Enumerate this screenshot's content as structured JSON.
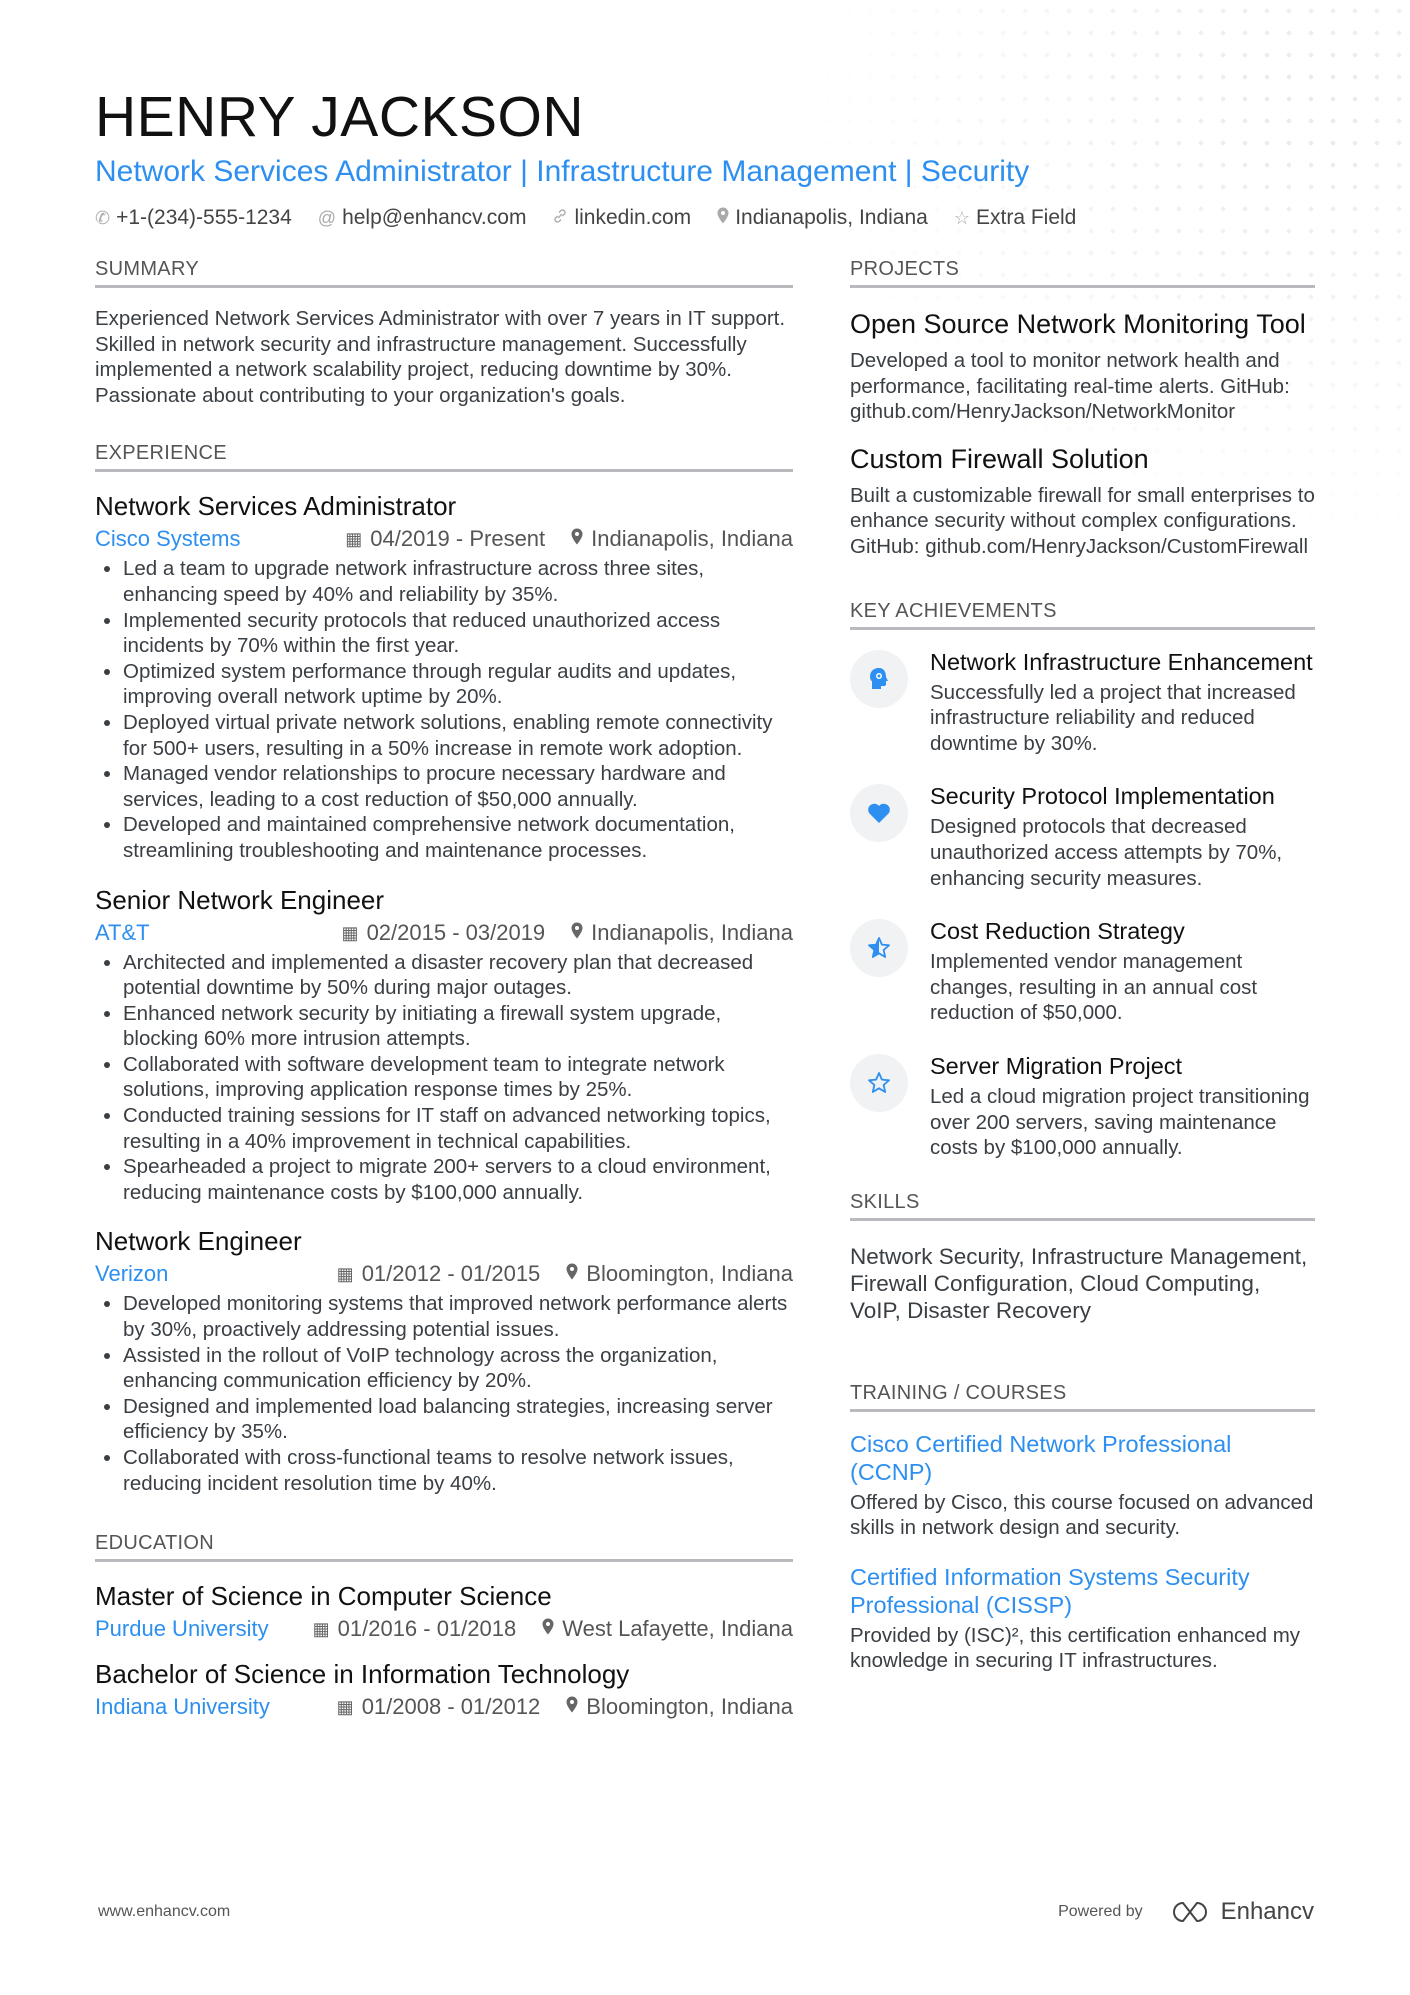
{
  "header": {
    "name": "HENRY JACKSON",
    "title": "Network Services Administrator | Infrastructure Management | Security",
    "contacts": [
      {
        "icon": "phone-icon",
        "glyph": "✆",
        "text": "+1-(234)-555-1234"
      },
      {
        "icon": "at-icon",
        "glyph": "@",
        "text": "help@enhancv.com"
      },
      {
        "icon": "link-icon",
        "glyph": "🔗",
        "text": "linkedin.com"
      },
      {
        "icon": "location-pin-icon",
        "glyph": "⚲",
        "text": "Indianapolis, Indiana"
      },
      {
        "icon": "star-icon",
        "glyph": "☆",
        "text": "Extra Field"
      }
    ]
  },
  "summary": {
    "heading": "SUMMARY",
    "text": "Experienced Network Services Administrator with over 7 years in IT support. Skilled in network security and infrastructure management. Successfully implemented a network scalability project, reducing downtime by 30%. Passionate about contributing to your organization's goals."
  },
  "experience": {
    "heading": "EXPERIENCE",
    "jobs": [
      {
        "title": "Network Services Administrator",
        "company": "Cisco Systems",
        "dates": "04/2019 - Present",
        "location": "Indianapolis, Indiana",
        "bullets": [
          "Led a team to upgrade network infrastructure across three sites, enhancing speed by 40% and reliability by 35%.",
          "Implemented security protocols that reduced unauthorized access incidents by 70% within the first year.",
          "Optimized system performance through regular audits and updates, improving overall network uptime by 20%.",
          "Deployed virtual private network solutions, enabling remote connectivity for 500+ users, resulting in a 50% increase in remote work adoption.",
          "Managed vendor relationships to procure necessary hardware and services, leading to a cost reduction of $50,000 annually.",
          "Developed and maintained comprehensive network documentation, streamlining troubleshooting and maintenance processes."
        ]
      },
      {
        "title": "Senior Network Engineer",
        "company": "AT&T",
        "dates": "02/2015 - 03/2019",
        "location": "Indianapolis, Indiana",
        "bullets": [
          "Architected and implemented a disaster recovery plan that decreased potential downtime by 50% during major outages.",
          "Enhanced network security by initiating a firewall system upgrade, blocking 60% more intrusion attempts.",
          "Collaborated with software development team to integrate network solutions, improving application response times by 25%.",
          "Conducted training sessions for IT staff on advanced networking topics, resulting in a 40% improvement in technical capabilities.",
          "Spearheaded a project to migrate 200+ servers to a cloud environment, reducing maintenance costs by $100,000 annually."
        ]
      },
      {
        "title": "Network Engineer",
        "company": "Verizon",
        "dates": "01/2012 - 01/2015",
        "location": "Bloomington, Indiana",
        "bullets": [
          "Developed monitoring systems that improved network performance alerts by 30%, proactively addressing potential issues.",
          "Assisted in the rollout of VoIP technology across the organization, enhancing communication efficiency by 20%.",
          "Designed and implemented load balancing strategies, increasing server efficiency by 35%.",
          "Collaborated with cross-functional teams to resolve network issues, reducing incident resolution time by 40%."
        ]
      }
    ]
  },
  "education": {
    "heading": "EDUCATION",
    "items": [
      {
        "degree": "Master of Science in Computer Science",
        "school": "Purdue University",
        "dates": "01/2016 - 01/2018",
        "location": "West Lafayette, Indiana"
      },
      {
        "degree": "Bachelor of Science in Information Technology",
        "school": "Indiana University",
        "dates": "01/2008 - 01/2012",
        "location": "Bloomington, Indiana"
      }
    ]
  },
  "projects": {
    "heading": "PROJECTS",
    "items": [
      {
        "title": "Open Source Network Monitoring Tool",
        "desc": "Developed a tool to monitor network health and performance, facilitating real-time alerts. GitHub: github.com/HenryJackson/NetworkMonitor"
      },
      {
        "title": "Custom Firewall Solution",
        "desc": "Built a customizable firewall for small enterprises to enhance security without complex configurations. GitHub: github.com/HenryJackson/CustomFirewall"
      }
    ]
  },
  "achievements": {
    "heading": "KEY ACHIEVEMENTS",
    "items": [
      {
        "icon": "head-idea-icon",
        "glyph": "☻",
        "title": "Network Infrastructure Enhancement",
        "desc": "Successfully led a project that increased infrastructure reliability and reduced downtime by 30%."
      },
      {
        "icon": "heart-icon",
        "glyph": "♥",
        "title": "Security Protocol Implementation",
        "desc": "Designed protocols that decreased unauthorized access attempts by 70%, enhancing security measures."
      },
      {
        "icon": "half-star-icon",
        "glyph": "★",
        "title": "Cost Reduction Strategy",
        "desc": "Implemented vendor management changes, resulting in an annual cost reduction of $50,000."
      },
      {
        "icon": "star-outline-icon",
        "glyph": "☆",
        "title": "Server Migration Project",
        "desc": "Led a cloud migration project transitioning over 200 servers, saving maintenance costs by $100,000 annually."
      }
    ]
  },
  "skills": {
    "heading": "SKILLS",
    "text": "Network Security, Infrastructure Management, Firewall Configuration, Cloud Computing, VoIP, Disaster Recovery"
  },
  "training": {
    "heading": "TRAINING / COURSES",
    "items": [
      {
        "title": "Cisco Certified Network Professional (CCNP)",
        "desc": "Offered by Cisco, this course focused on advanced skills in network design and security."
      },
      {
        "title": "Certified Information Systems Security Professional (CISSP)",
        "desc": "Provided by (ISC)², this certification enhanced my knowledge in securing IT infrastructures."
      }
    ]
  },
  "footer": {
    "website": "www.enhancv.com",
    "powered_by": "Powered by",
    "brand": "Enhancv"
  },
  "colors": {
    "accent": "#2d8ff0",
    "rule": "#b8babd",
    "text": "#3a3f44"
  }
}
